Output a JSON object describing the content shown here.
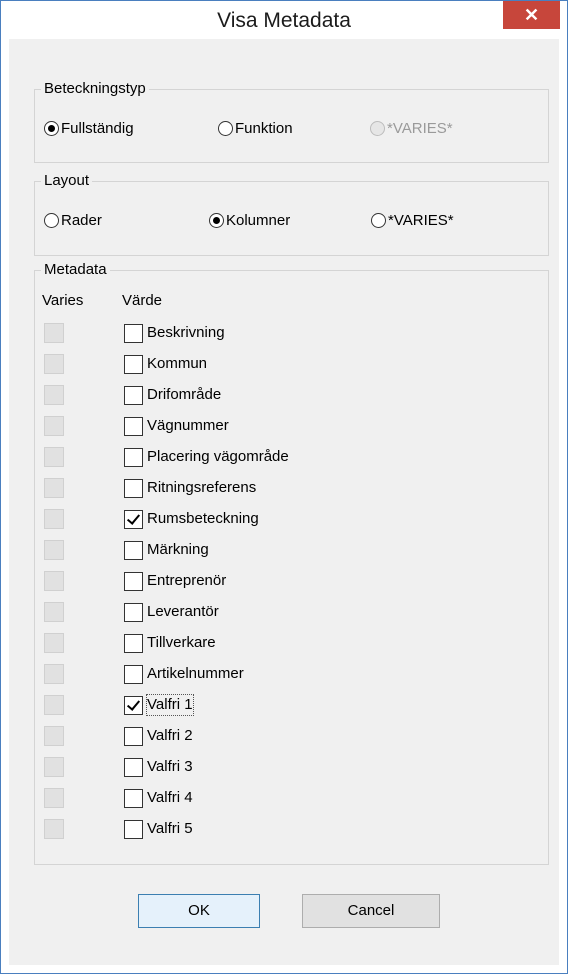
{
  "window": {
    "title": "Visa Metadata",
    "close_glyph": "✕"
  },
  "beteckningstyp": {
    "legend": "Beteckningstyp",
    "options": [
      {
        "label": "Fullständig",
        "checked": true,
        "disabled": false
      },
      {
        "label": "Funktion",
        "checked": false,
        "disabled": false
      },
      {
        "label": "*VARIES*",
        "checked": false,
        "disabled": true
      }
    ]
  },
  "layout": {
    "legend": "Layout",
    "options": [
      {
        "label": "Rader",
        "checked": false,
        "disabled": false
      },
      {
        "label": "Kolumner",
        "checked": true,
        "disabled": false
      },
      {
        "label": "*VARIES*",
        "checked": false,
        "disabled": false
      }
    ]
  },
  "metadata": {
    "legend": "Metadata",
    "col_varies": "Varies",
    "col_value": "Värde",
    "items": [
      {
        "label": "Beskrivning",
        "checked": false,
        "focused": false
      },
      {
        "label": "Kommun",
        "checked": false,
        "focused": false
      },
      {
        "label": "Drifområde",
        "checked": false,
        "focused": false
      },
      {
        "label": "Vägnummer",
        "checked": false,
        "focused": false
      },
      {
        "label": "Placering vägområde",
        "checked": false,
        "focused": false
      },
      {
        "label": "Ritningsreferens",
        "checked": false,
        "focused": false
      },
      {
        "label": "Rumsbeteckning",
        "checked": true,
        "focused": false
      },
      {
        "label": "Märkning",
        "checked": false,
        "focused": false
      },
      {
        "label": "Entreprenör",
        "checked": false,
        "focused": false
      },
      {
        "label": "Leverantör",
        "checked": false,
        "focused": false
      },
      {
        "label": "Tillverkare",
        "checked": false,
        "focused": false
      },
      {
        "label": "Artikelnummer",
        "checked": false,
        "focused": false
      },
      {
        "label": "Valfri 1",
        "checked": true,
        "focused": true
      },
      {
        "label": "Valfri 2",
        "checked": false,
        "focused": false
      },
      {
        "label": "Valfri 3",
        "checked": false,
        "focused": false
      },
      {
        "label": "Valfri 4",
        "checked": false,
        "focused": false
      },
      {
        "label": "Valfri 5",
        "checked": false,
        "focused": false
      }
    ]
  },
  "buttons": {
    "ok": "OK",
    "cancel": "Cancel"
  },
  "colors": {
    "close": "#c7463b",
    "frame_border": "#4a7fbf",
    "default_button": "#3c7fb1"
  }
}
